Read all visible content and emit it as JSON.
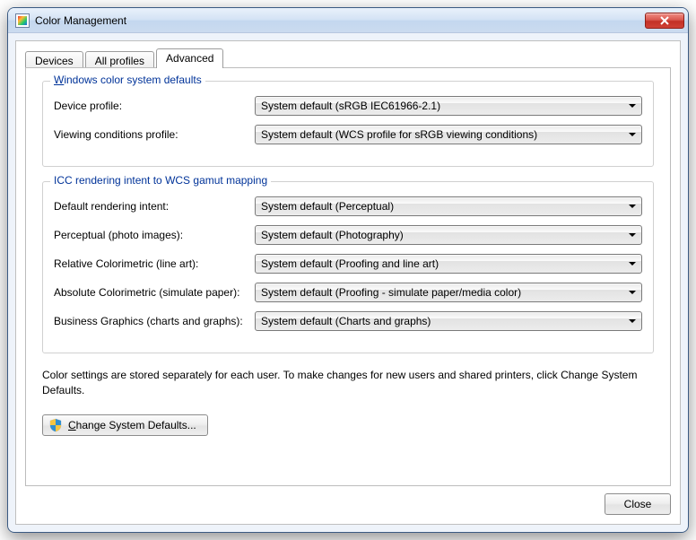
{
  "window": {
    "title": "Color Management"
  },
  "tabs": {
    "devices": "Devices",
    "all_profiles": "All profiles",
    "advanced": "Advanced"
  },
  "group_wcs": {
    "legend": "Windows color system defaults",
    "device_profile_label": "Device profile:",
    "device_profile_value": "System default (sRGB IEC61966-2.1)",
    "viewing_label": "Viewing conditions profile:",
    "viewing_value": "System default (WCS profile for sRGB viewing conditions)"
  },
  "group_icc": {
    "legend": "ICC  rendering intent to WCS gamut mapping",
    "default_intent_label": "Default rendering intent:",
    "default_intent_value": "System default (Perceptual)",
    "perceptual_label": "Perceptual (photo images):",
    "perceptual_value": "System default (Photography)",
    "relative_label": "Relative Colorimetric (line art):",
    "relative_value": "System default (Proofing and line art)",
    "absolute_label": "Absolute Colorimetric (simulate paper):",
    "absolute_value": "System default (Proofing - simulate paper/media color)",
    "business_label": "Business Graphics (charts and graphs):",
    "business_value": "System default (Charts and graphs)"
  },
  "info_text": "Color settings are stored separately for each user. To make changes for new users and shared printers, click Change System Defaults.",
  "buttons": {
    "change_system_defaults": "Change System Defaults...",
    "close": "Close"
  }
}
